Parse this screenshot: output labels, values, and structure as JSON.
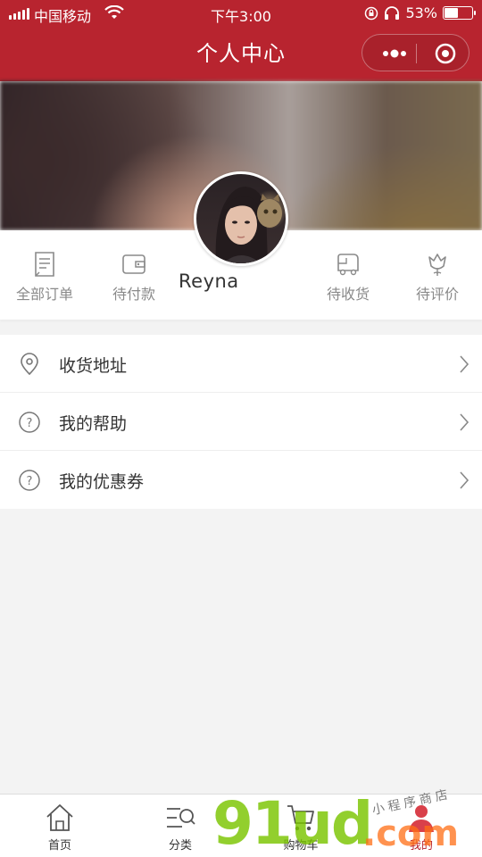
{
  "status_bar": {
    "carrier": "中国移动",
    "time": "下午3:00",
    "battery_percent": "53%",
    "battery_level": 0.53,
    "icons": [
      "signal-icon",
      "wifi-icon",
      "lock-rotation-icon",
      "headphones-icon",
      "battery-icon"
    ]
  },
  "nav": {
    "title": "个人中心",
    "menu_button_icon": "more-dots-icon",
    "close_button_icon": "target-icon"
  },
  "profile": {
    "username": "Reyna",
    "avatar_icon": "avatar"
  },
  "orders": [
    {
      "label": "全部订单",
      "icon": "document-icon"
    },
    {
      "label": "待付款",
      "icon": "wallet-icon"
    },
    {
      "label": "待收货",
      "icon": "truck-icon"
    },
    {
      "label": "待评价",
      "icon": "flower-icon"
    }
  ],
  "menu": [
    {
      "label": "收货地址",
      "icon": "location-pin-icon"
    },
    {
      "label": "我的帮助",
      "icon": "question-circle-icon"
    },
    {
      "label": "我的优惠券",
      "icon": "question-circle-icon"
    }
  ],
  "tabbar": [
    {
      "label": "首页",
      "icon": "home-icon"
    },
    {
      "label": "分类",
      "icon": "category-search-icon"
    },
    {
      "label": "购物车",
      "icon": "cart-icon"
    },
    {
      "label": "我的",
      "icon": "user-icon",
      "active": true
    }
  ],
  "watermark": {
    "logo_text": "91ud",
    "suffix": ".com",
    "tagline": "小程序商店"
  },
  "colors": {
    "brand": "#b8242f",
    "watermark_green": "#7ac400",
    "watermark_orange": "#ff6e14"
  }
}
